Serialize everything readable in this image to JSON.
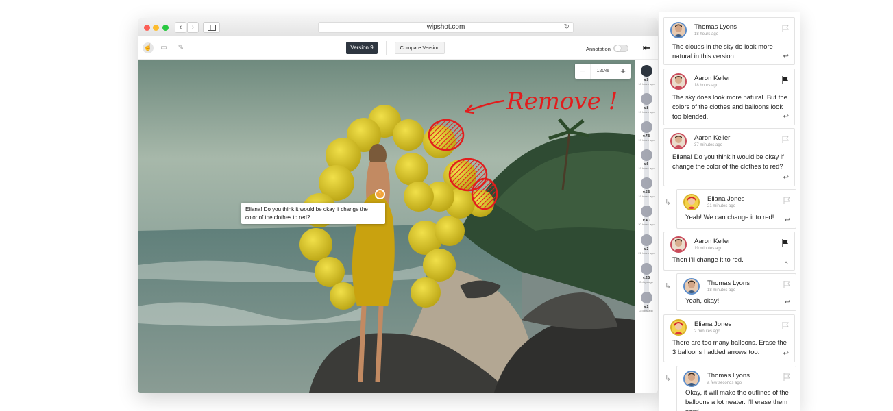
{
  "browser": {
    "url": "wipshot.com"
  },
  "toolbar": {
    "version_label": "Version.9",
    "compare_label": "Compare Version",
    "annotation_label": "Annotation"
  },
  "canvas": {
    "zoom_value": "120%",
    "annotation_text": "Remove !",
    "pin_number": "1",
    "tooltip_text": "Eliana! Do you think it would be okay if change the color of the clothes to red?"
  },
  "timeline": {
    "versions": [
      {
        "label": "v.9",
        "time": "18 hours ago"
      },
      {
        "label": "v.8",
        "time": "19 hours ago"
      },
      {
        "label": "v.7B",
        "time": "19 hours ago"
      },
      {
        "label": "v.6",
        "time": "19 hours ago"
      },
      {
        "label": "v.5B",
        "time": "19 hours ago"
      },
      {
        "label": "v.4C",
        "time": "20 hours ago"
      },
      {
        "label": "v.3",
        "time": "21 hours ago"
      },
      {
        "label": "v.2B",
        "time": "2 days ago"
      },
      {
        "label": "v.1",
        "time": "2 days ago"
      }
    ]
  },
  "comments": [
    {
      "name": "Thomas Lyons",
      "time": "18 hours ago",
      "text": "The clouds in the sky do look more natural in this version.",
      "flagged": false,
      "reply_to": false
    },
    {
      "name": "Aaron Keller",
      "time": "18 hours ago",
      "text": "The sky does look more natural. But the colors of the clothes and balloons look too blended.",
      "flagged": true,
      "reply_to": false
    },
    {
      "name": "Aaron Keller",
      "time": "37 minutes ago",
      "text": "Eliana! Do you think it would be okay if change the color of the clothes to red?",
      "flagged": false,
      "reply_to": false
    },
    {
      "name": "Eliana Jones",
      "time": "21 minutes ago",
      "text": "Yeah! We can change it to red!",
      "flagged": false,
      "reply_to": true
    },
    {
      "name": "Aaron Keller",
      "time": "19 minutes ago",
      "text": "Then I'll change it to red.",
      "flagged": true,
      "reply_to": false
    },
    {
      "name": "Thomas Lyons",
      "time": "18 minutes ago",
      "text": "Yeah, okay!",
      "flagged": false,
      "reply_to": true
    },
    {
      "name": "Eliana Jones",
      "time": "2 minutes ago",
      "text": "There are too many balloons. Erase the 3 balloons I added arrows too.",
      "flagged": false,
      "reply_to": false
    },
    {
      "name": "Thomas Lyons",
      "time": "a few seconds ago",
      "text": "Okay, it will make the outlines of the balloons a lot neater. I'll erase them now!",
      "flagged": false,
      "reply_to": true
    }
  ],
  "colors": {
    "dark": "#2e3640",
    "annotation_red": "#e21d1d",
    "pin": "#f2a43a",
    "timeline_dot": "#a6a9b4"
  }
}
